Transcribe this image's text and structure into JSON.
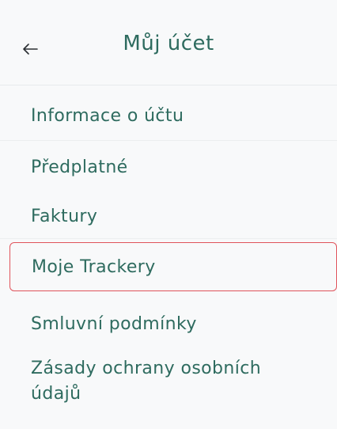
{
  "header": {
    "back_icon": "arrow-left-icon",
    "title": "Můj účet"
  },
  "menu": {
    "items": [
      {
        "label": "Informace o účtu"
      },
      {
        "label": "Předplatné"
      },
      {
        "label": "Faktury"
      },
      {
        "label": "Moje Trackery"
      },
      {
        "label": "Smluvní podmínky"
      },
      {
        "label_line1": "Zásady ochrany osobních",
        "label_line2": "údajů"
      }
    ]
  },
  "colors": {
    "text": "#2e6b5f",
    "highlight_border": "#e0535b",
    "background": "#f8f9fa"
  }
}
